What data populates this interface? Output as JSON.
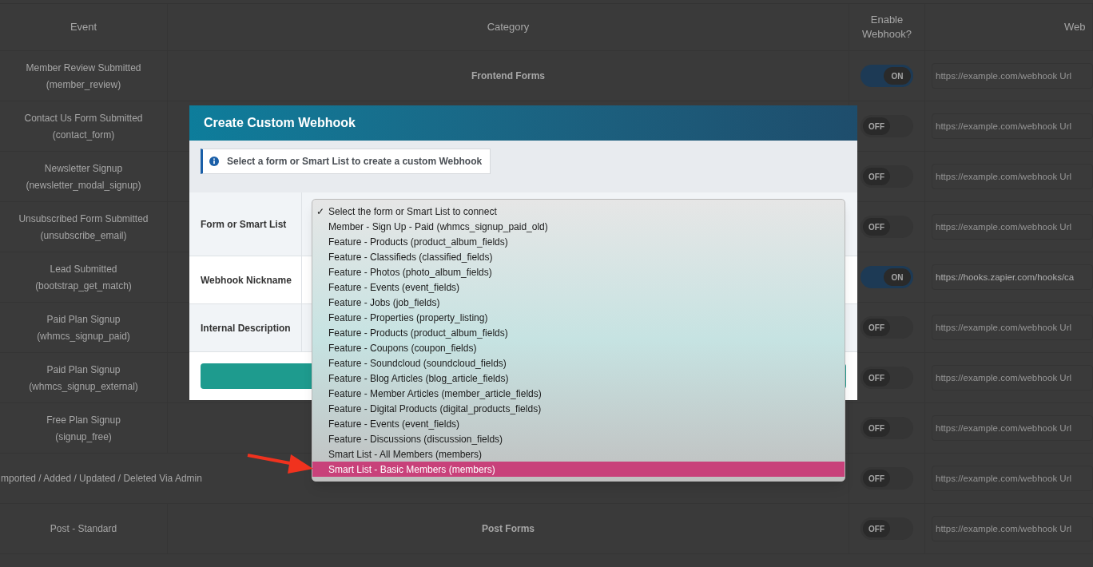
{
  "table": {
    "columns": [
      "Event",
      "Category",
      "Enable Webhook?",
      "Web"
    ],
    "rows": [
      {
        "event": "Member Review Submitted",
        "code": "(member_review)",
        "category": "Frontend Forms",
        "on": true,
        "toggle_label": "ON",
        "url": "",
        "placeholder": "https://example.com/webhook Url"
      },
      {
        "event": "Contact Us Form Submitted",
        "code": "(contact_form)",
        "on": false,
        "toggle_label": "OFF",
        "url": "",
        "placeholder": "https://example.com/webhook Url"
      },
      {
        "event": "Newsletter Signup",
        "code": "(newsletter_modal_signup)",
        "on": false,
        "toggle_label": "OFF",
        "url": "",
        "placeholder": "https://example.com/webhook Url"
      },
      {
        "event": "Unsubscribed Form Submitted",
        "code": "(unsubscribe_email)",
        "on": false,
        "toggle_label": "OFF",
        "url": "",
        "placeholder": "https://example.com/webhook Url"
      },
      {
        "event": "Lead Submitted",
        "code": "(bootstrap_get_match)",
        "on": true,
        "toggle_label": "ON",
        "url": "https://hooks.zapier.com/hooks/ca"
      },
      {
        "event": "Paid Plan Signup",
        "code": "(whmcs_signup_paid)",
        "on": false,
        "toggle_label": "OFF",
        "url": "",
        "placeholder": "https://example.com/webhook Url"
      },
      {
        "event": "Paid Plan Signup",
        "code": "(whmcs_signup_external)",
        "on": false,
        "toggle_label": "OFF",
        "url": "",
        "placeholder": "https://example.com/webhook Url"
      },
      {
        "event": "Free Plan Signup",
        "code": "(signup_free)",
        "on": false,
        "toggle_label": "OFF",
        "url": "",
        "placeholder": "https://example.com/webhook Url"
      },
      {
        "event": "mported / Added / Updated / Deleted Via Admin",
        "overflow": true,
        "on": false,
        "toggle_label": "OFF",
        "url": "",
        "placeholder": "https://example.com/webhook Url"
      },
      {
        "event": "Post - Standard",
        "category": "Post Forms",
        "on": false,
        "toggle_label": "OFF",
        "url": "",
        "placeholder": "https://example.com/webhook Url"
      }
    ]
  },
  "modal": {
    "title": "Create Custom Webhook",
    "info": "Select a form or Smart List to create a custom Webhook",
    "fields": [
      {
        "label": "Form or Smart List"
      },
      {
        "label": "Webhook Nickname"
      },
      {
        "label": "Internal Description"
      }
    ],
    "dropdown": {
      "check": "✓",
      "options": [
        {
          "label": "Select the form or Smart List to connect",
          "checked": true,
          "selected": false
        },
        {
          "label": "Member - Sign Up - Paid (whmcs_signup_paid_old)",
          "checked": false,
          "selected": false
        },
        {
          "label": "Feature - Products (product_album_fields)",
          "checked": false,
          "selected": false
        },
        {
          "label": "Feature - Classifieds (classified_fields)",
          "checked": false,
          "selected": false
        },
        {
          "label": "Feature - Photos (photo_album_fields)",
          "checked": false,
          "selected": false
        },
        {
          "label": "Feature - Events (event_fields)",
          "checked": false,
          "selected": false
        },
        {
          "label": "Feature - Jobs (job_fields)",
          "checked": false,
          "selected": false
        },
        {
          "label": "Feature - Properties (property_listing)",
          "checked": false,
          "selected": false
        },
        {
          "label": "Feature - Products (product_album_fields)",
          "checked": false,
          "selected": false
        },
        {
          "label": "Feature - Coupons (coupon_fields)",
          "checked": false,
          "selected": false
        },
        {
          "label": "Feature - Soundcloud (soundcloud_fields)",
          "checked": false,
          "selected": false
        },
        {
          "label": "Feature - Blog Articles (blog_article_fields)",
          "checked": false,
          "selected": false
        },
        {
          "label": "Feature - Member Articles (member_article_fields)",
          "checked": false,
          "selected": false
        },
        {
          "label": "Feature - Digital Products (digital_products_fields)",
          "checked": false,
          "selected": false
        },
        {
          "label": "Feature - Events (event_fields)",
          "checked": false,
          "selected": false
        },
        {
          "label": "Feature - Discussions (discussion_fields)",
          "checked": false,
          "selected": false
        },
        {
          "label": "Smart List - All Members (members)",
          "checked": false,
          "selected": false
        },
        {
          "label": "Smart List - Basic Members (members)",
          "checked": false,
          "selected": true
        }
      ]
    }
  }
}
